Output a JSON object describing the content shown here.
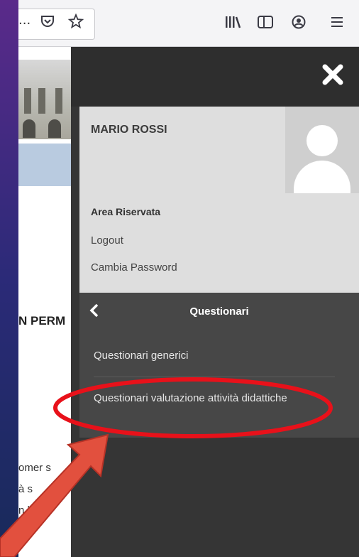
{
  "browser": {
    "url_overflow": "···",
    "toolbar_icons": [
      "pocket-icon",
      "star-icon",
      "library-icon",
      "sidebar-icon",
      "account-icon",
      "hamburger-menu-icon"
    ]
  },
  "page_background": {
    "heading_fragment": "N PERM",
    "text_fragments": [
      "omer s",
      "à s",
      "n l'im"
    ]
  },
  "menu": {
    "close_icon": "close-icon",
    "user": {
      "name": "MARIO ROSSI",
      "avatar_icon": "default-avatar-icon"
    },
    "area_title": "Area Riservata",
    "links": [
      "Logout",
      "Cambia Password"
    ],
    "submenu": {
      "back_icon": "chevron-left-icon",
      "title": "Questionari",
      "items": [
        "Questionari generici",
        "Questionari valutazione attività didattiche"
      ]
    }
  },
  "annotation": {
    "highlight_color": "#e8111a",
    "arrow_color": "#e2503e"
  }
}
